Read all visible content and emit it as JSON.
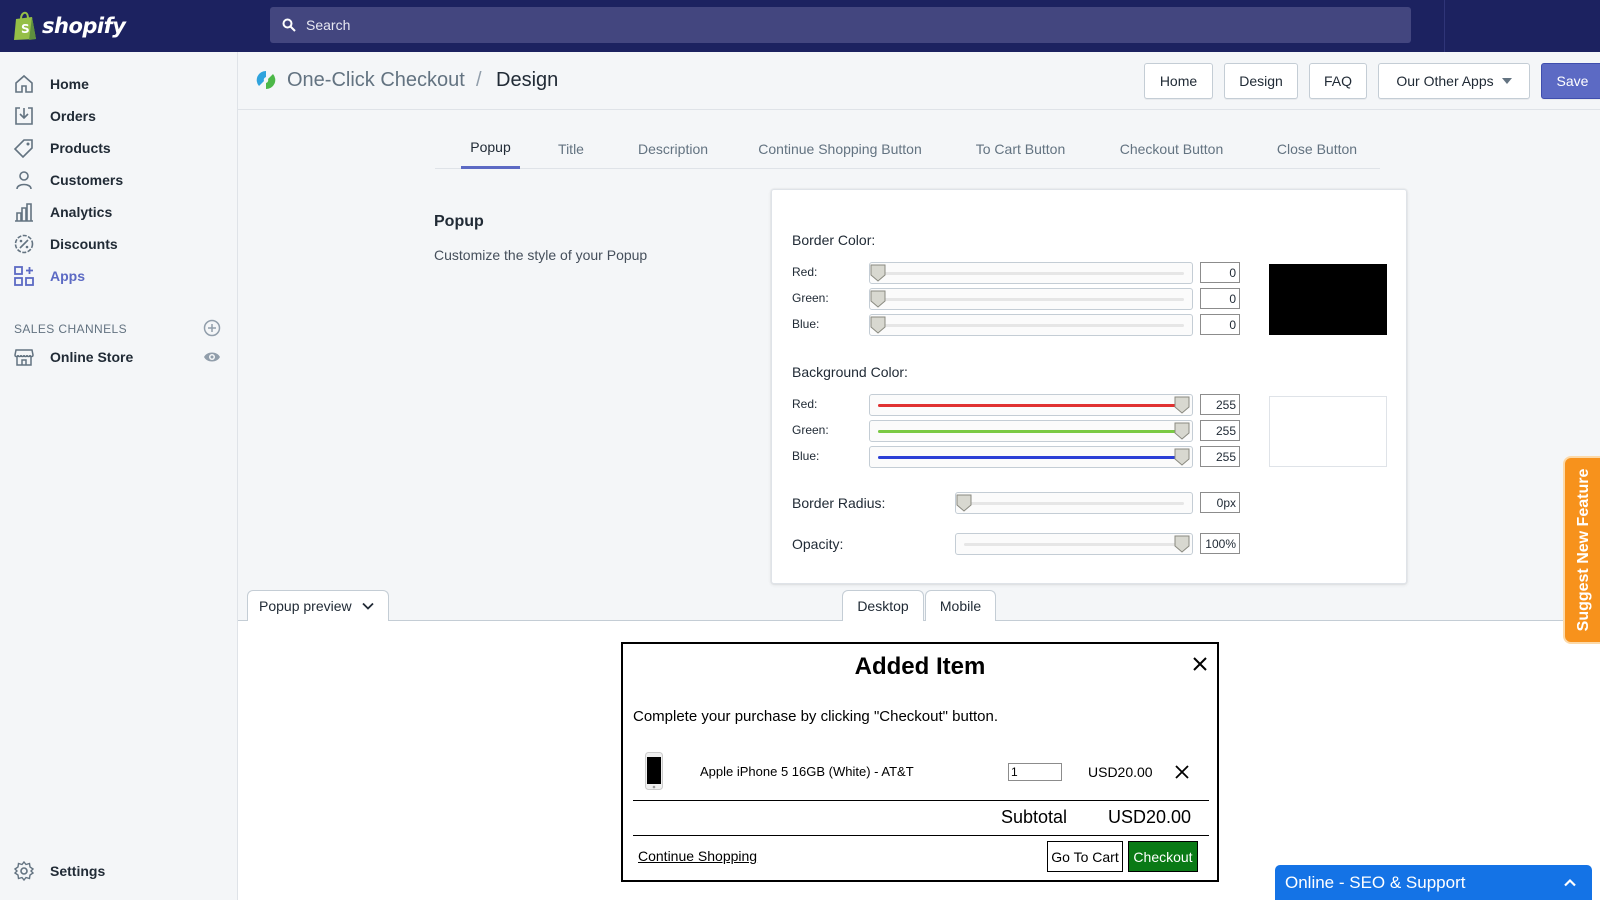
{
  "topbar": {
    "logo_text": "shopify",
    "search_placeholder": "Search"
  },
  "sidebar": {
    "items": [
      {
        "label": "Home",
        "icon": "home-icon"
      },
      {
        "label": "Orders",
        "icon": "orders-icon"
      },
      {
        "label": "Products",
        "icon": "tag-icon"
      },
      {
        "label": "Customers",
        "icon": "person-icon"
      },
      {
        "label": "Analytics",
        "icon": "bar-chart-icon"
      },
      {
        "label": "Discounts",
        "icon": "discount-icon"
      },
      {
        "label": "Apps",
        "icon": "apps-icon",
        "active": true
      }
    ],
    "sales_channels_heading": "SALES CHANNELS",
    "online_store": "Online Store",
    "settings": "Settings"
  },
  "header": {
    "app_name": "One-Click Checkout",
    "separator": "/",
    "page": "Design",
    "buttons": {
      "home": "Home",
      "design": "Design",
      "faq": "FAQ",
      "other_apps": "Our Other Apps",
      "save": "Save"
    }
  },
  "tabs": [
    {
      "label": "Popup",
      "active": true
    },
    {
      "label": "Title"
    },
    {
      "label": "Description"
    },
    {
      "label": "Continue Shopping Button"
    },
    {
      "label": "To Cart Button"
    },
    {
      "label": "Checkout Button"
    },
    {
      "label": "Close Button"
    }
  ],
  "section": {
    "title": "Popup",
    "description": "Customize the style of your Popup"
  },
  "card": {
    "border_color": {
      "label": "Border Color:",
      "red_label": "Red:",
      "green_label": "Green:",
      "blue_label": "Blue:",
      "red": "0",
      "green": "0",
      "blue": "0",
      "preview_hex": "#000000"
    },
    "background_color": {
      "label": "Background Color:",
      "red_label": "Red:",
      "green_label": "Green:",
      "blue_label": "Blue:",
      "red": "255",
      "green": "255",
      "blue": "255",
      "preview_hex": "#ffffff"
    },
    "border_radius": {
      "label": "Border Radius:",
      "value": "0px",
      "level": 0
    },
    "opacity": {
      "label": "Opacity:",
      "value": "100%",
      "level": 1
    }
  },
  "preview": {
    "toggle_label": "Popup preview",
    "tab_desktop": "Desktop",
    "tab_mobile": "Mobile"
  },
  "popup": {
    "title": "Added Item",
    "message": "Complete your purchase by clicking \"Checkout\" button.",
    "product_name": "Apple iPhone 5 16GB (White) - AT&T",
    "quantity": "1",
    "price": "USD20.00",
    "subtotal_label": "Subtotal",
    "subtotal_value": "USD20.00",
    "continue_shopping": "Continue Shopping",
    "go_to_cart": "Go To Cart",
    "checkout": "Checkout"
  },
  "widgets": {
    "suggest": "Suggest New Feature",
    "chat": "Online - SEO & Support"
  },
  "colors": {
    "topbar": "#1c2260",
    "accent": "#5c6ac4",
    "checkout_green": "#0a7a16",
    "suggest_orange": "#f7921c",
    "chat_blue": "#1473e6",
    "slider_red": "#e03131",
    "slider_green": "#7ac943",
    "slider_blue": "#2b3fd6"
  }
}
